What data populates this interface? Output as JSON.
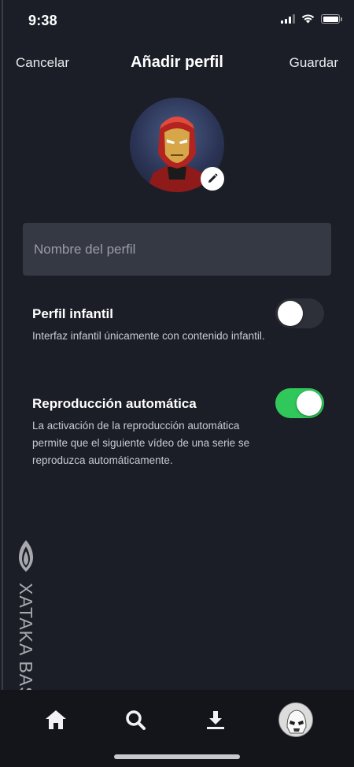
{
  "status_bar": {
    "time": "9:38"
  },
  "header": {
    "cancel_label": "Cancelar",
    "title": "Añadir perfil",
    "save_label": "Guardar"
  },
  "profile": {
    "avatar_icon": "iron-man-avatar",
    "edit_icon": "pencil-icon"
  },
  "name_field": {
    "placeholder": "Nombre del perfil",
    "value": ""
  },
  "settings": [
    {
      "title": "Perfil infantil",
      "description": "Interfaz infantil únicamente con contenido infantil.",
      "enabled": false
    },
    {
      "title": "Reproducción automática",
      "description": "La activación de la reproducción automática permite que el siguiente vídeo de una serie se reproduzca automáticamente.",
      "enabled": true
    }
  ],
  "watermark": {
    "text": "XATAKA BASICS"
  },
  "tab_bar": {
    "items": [
      "home-icon",
      "search-icon",
      "download-icon",
      "profile-avatar"
    ]
  },
  "colors": {
    "background": "#1b1e27",
    "toggle_on": "#30c85a",
    "toggle_off": "#2d3039",
    "field_bg": "#353944"
  }
}
